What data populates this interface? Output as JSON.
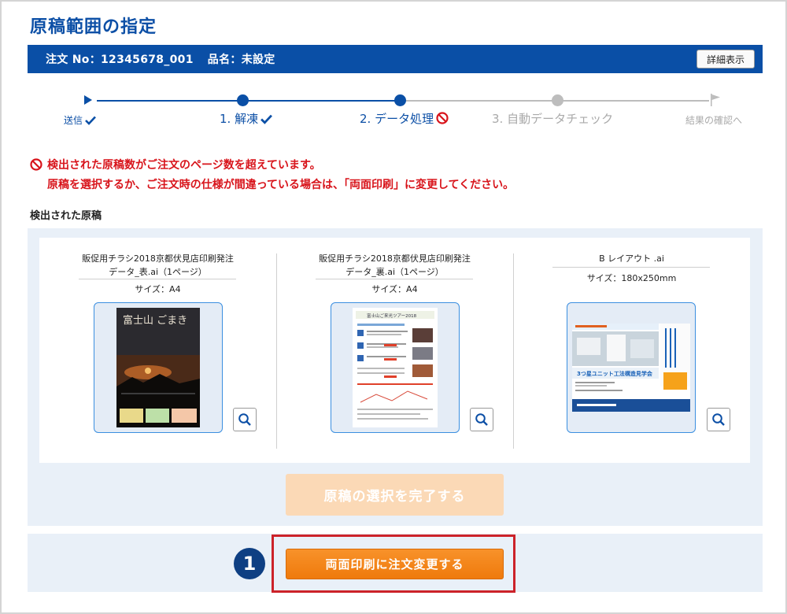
{
  "page": {
    "title": "原稿範囲の指定"
  },
  "order_bar": {
    "order_no_label": "注文 No：",
    "order_no": "12345678_001",
    "item_label": "品名：",
    "item_name": "未設定",
    "detail_button": "詳細表示"
  },
  "progress": {
    "steps": [
      {
        "label": "送信",
        "state": "done"
      },
      {
        "label": "1. 解凍",
        "state": "done"
      },
      {
        "label": "2. データ処理",
        "state": "error"
      },
      {
        "label": "3. 自動データチェック",
        "state": "pending"
      },
      {
        "label": "結果の確認へ",
        "state": "pending"
      }
    ],
    "active_color": "#0a4fa6",
    "inactive_color": "#bdbdbd"
  },
  "error": {
    "line1": "検出された原稿数がご注文のページ数を超えています。",
    "line2": "原稿を選択するか、ご注文時の仕様が間違っている場合は、「両面印刷」に変更してください。",
    "color": "#d8141b"
  },
  "detected": {
    "section_label": "検出された原稿",
    "files": [
      {
        "title_line1": "販促用チラシ2018京都伏見店印刷発注",
        "title_line2": "データ_表.ai（1ページ）",
        "size": "サイズ：A4",
        "thumb_text": "富士山 ごまき"
      },
      {
        "title_line1": "販促用チラシ2018京都伏見店印刷発注",
        "title_line2": "データ_裏.ai（1ページ）",
        "size": "サイズ：A4",
        "thumb_text": "富士山ご来光ツアー2018"
      },
      {
        "title_line1": "B レイアウト .ai",
        "title_line2": "",
        "size": "サイズ：180x250mm",
        "thumb_text": "3つ星ユニット工法構造見学会"
      }
    ]
  },
  "buttons": {
    "complete": "原稿の選択を完了する",
    "duplex": "両面印刷に注文変更する",
    "badge": "1"
  }
}
